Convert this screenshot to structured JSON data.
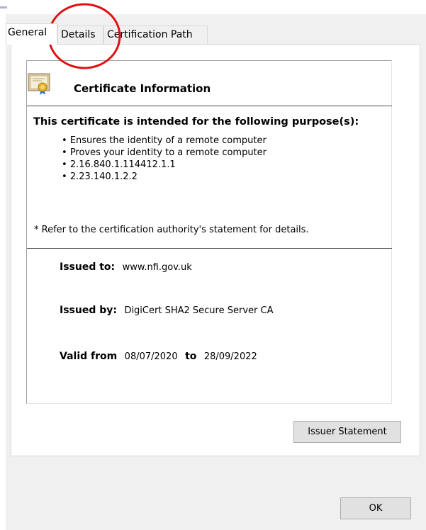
{
  "tabs": {
    "general": "General",
    "details": "Details",
    "certification_path": "Certification Path"
  },
  "info": {
    "title": "Certificate Information",
    "purpose_heading": "This certificate is intended for the following purpose(s):",
    "purposes": [
      "Ensures the identity of a remote computer",
      "Proves your identity to a remote computer",
      "2.16.840.1.114412.1.1",
      "2.23.140.1.2.2"
    ],
    "note": "* Refer to the certification authority's statement for details.",
    "issued_to_label": "Issued to:",
    "issued_to_value": "www.nfi.gov.uk",
    "issued_by_label": "Issued by:",
    "issued_by_value": "DigiCert SHA2 Secure Server CA",
    "valid_from_label": "Valid from",
    "valid_from_value": "08/07/2020",
    "valid_to_label": "to",
    "valid_to_value": "28/09/2022"
  },
  "buttons": {
    "issuer_statement": "Issuer Statement",
    "ok": "OK"
  },
  "annotation": {
    "color": "#e01010",
    "icon": "red-circle-highlight"
  }
}
